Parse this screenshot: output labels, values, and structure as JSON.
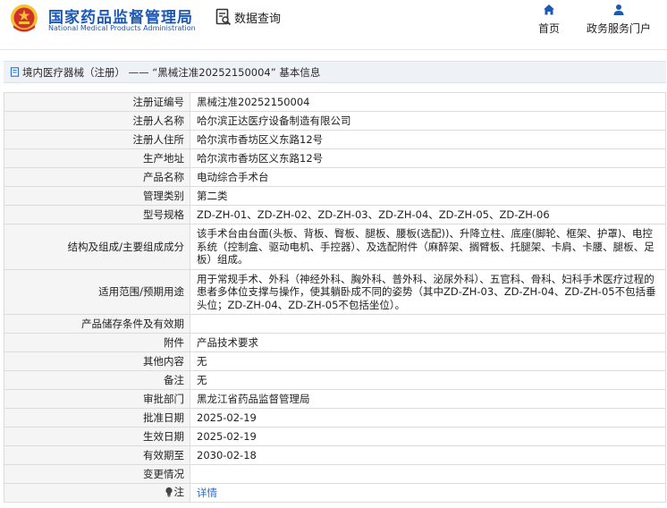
{
  "header": {
    "title_cn": "国家药品监督管理局",
    "title_en": "National Medical Products Administration",
    "db_query_label": "数据查询",
    "nav": {
      "home_label": "首页",
      "gov_service_label": "政务服务门户"
    }
  },
  "breadcrumb": {
    "text": "境内医疗器械（注册） —— “黑械注准20252150004” 基本信息"
  },
  "rows": [
    {
      "key": "注册证编号",
      "value": "黑械注准20252150004"
    },
    {
      "key": "注册人名称",
      "value": "哈尔滨正达医疗设备制造有限公司"
    },
    {
      "key": "注册人住所",
      "value": "哈尔滨市香坊区义东路12号"
    },
    {
      "key": "生产地址",
      "value": "哈尔滨市香坊区义东路12号"
    },
    {
      "key": "产品名称",
      "value": "电动综合手术台"
    },
    {
      "key": "管理类别",
      "value": "第二类"
    },
    {
      "key": "型号规格",
      "value": "ZD-ZH-01、ZD-ZH-02、ZD-ZH-03、ZD-ZH-04、ZD-ZH-05、ZD-ZH-06"
    },
    {
      "key": "结构及组成/主要组成成分",
      "value": "该手术台由台面(头板、背板、臀板、腿板、腰板(选配))、升降立柱、底座(脚轮、框架、护罩)、电控系统（控制盒、驱动电机、手控器）、及选配附件（麻醉架、搁臂板、托腿架、卡肩、卡腰、腿板、足板）组成。"
    },
    {
      "key": "适用范围/预期用途",
      "value": "用于常规手术、外科（神经外科、胸外科、普外科、泌尿外科）、五官科、骨科、妇科手术医疗过程的患者多体位支撑与操作，使其躺卧成不同的姿势（其中ZD-ZH-03、ZD-ZH-04、ZD-ZH-05不包括垂头位；ZD-ZH-04、ZD-ZH-05不包括坐位）。"
    },
    {
      "key": "产品储存条件及有效期",
      "value": ""
    },
    {
      "key": "附件",
      "value": "产品技术要求"
    },
    {
      "key": "其他内容",
      "value": "无"
    },
    {
      "key": "备注",
      "value": "无"
    },
    {
      "key": "审批部门",
      "value": "黑龙江省药品监督管理局"
    },
    {
      "key": "批准日期",
      "value": "2025-02-19"
    },
    {
      "key": "生效日期",
      "value": "2025-02-19"
    },
    {
      "key": "有效期至",
      "value": "2030-02-18"
    },
    {
      "key": "变更情况",
      "value": ""
    }
  ],
  "note_row": {
    "key": "注",
    "link_label": "详情"
  },
  "colors": {
    "brand_blue": "#1c58b5",
    "link_blue": "#2a6bc9",
    "key_bg": "#f5f5f5",
    "emblem_red": "#d0312d",
    "emblem_gold": "#f2c230"
  },
  "icons": {
    "emblem": "national-emblem-icon",
    "db_query": "document-search-icon",
    "home": "home-icon",
    "gov": "user-icon",
    "crumb": "document-icon",
    "note": "lightbulb-icon"
  }
}
